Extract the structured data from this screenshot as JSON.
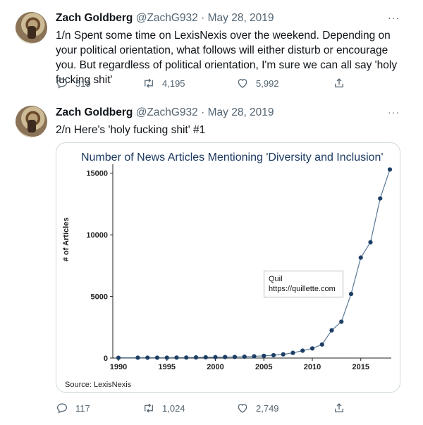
{
  "tweets": [
    {
      "author_name": "Zach Goldberg",
      "handle": "@ZachG932",
      "separator": "·",
      "date": "May 28, 2019",
      "more": "···",
      "text": "1/n Spent some time on LexisNexis over the weekend. Depending on your political orientation, what follows will either disturb or encourage you. But regardless of political orientation, I'm sure we can all say 'holy fucking shit'",
      "replies": "519",
      "retweets": "4,195",
      "likes": "5,992"
    },
    {
      "author_name": "Zach Goldberg",
      "handle": "@ZachG932",
      "separator": "·",
      "date": "May 28, 2019",
      "more": "···",
      "text": "2/n Here's 'holy fucking shit' #1",
      "replies": "117",
      "retweets": "1,024",
      "likes": "2,749"
    }
  ],
  "icons": {
    "reply": "reply-icon",
    "retweet": "retweet-icon",
    "like": "heart-icon",
    "share": "share-icon"
  },
  "colors": {
    "muted": "#536471",
    "series": "#1d3f66",
    "title": "#1d3a61"
  },
  "chart_data": {
    "type": "line",
    "title": "Number of News Articles Mentioning 'Diversity and Inclusion'",
    "ylabel": "# of Articles",
    "xlabel": "",
    "source": "Source: LexisNexis",
    "watermark_line1": "Quil",
    "watermark_line2": "https://quillette.com",
    "xlim": [
      1990,
      2018
    ],
    "ylim": [
      0,
      15500
    ],
    "x_ticks": [
      1990,
      1995,
      2000,
      2005,
      2010,
      2015
    ],
    "y_ticks": [
      0,
      5000,
      10000,
      15000
    ],
    "grid": false,
    "x": [
      1990,
      1992,
      1993,
      1994,
      1995,
      1996,
      1997,
      1998,
      1999,
      2000,
      2001,
      2002,
      2003,
      2004,
      2005,
      2006,
      2007,
      2008,
      2009,
      2010,
      2011,
      2012,
      2013,
      2014,
      2015,
      2016,
      2017,
      2018
    ],
    "y": [
      20,
      30,
      30,
      30,
      30,
      40,
      40,
      50,
      60,
      70,
      80,
      90,
      110,
      140,
      180,
      230,
      300,
      420,
      600,
      780,
      1100,
      2250,
      2950,
      5200,
      8150,
      9400,
      12950,
      15300
    ]
  }
}
